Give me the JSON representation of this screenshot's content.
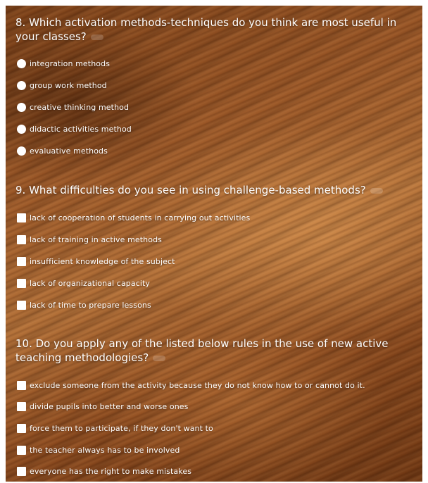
{
  "form": {
    "questions": [
      {
        "title": "8. Which activation methods-techniques do you think are most useful in your classes?",
        "input_type": "radio",
        "options": [
          "integration methods",
          "group work method",
          "creative thinking method",
          "didactic activities method",
          "evaluative methods"
        ]
      },
      {
        "title": "9. What difficulties do you see in using challenge-based methods?",
        "input_type": "checkbox",
        "options": [
          "lack of cooperation of students in carrying out activities",
          "lack of training in active methods",
          "insufficient knowledge of the subject",
          "lack of organizational capacity",
          "lack of time to prepare lessons"
        ]
      },
      {
        "title": "10. Do you apply any of the listed below rules in the use of new active teaching methodologies?",
        "input_type": "checkbox",
        "options": [
          "exclude someone from the activity because they do not know how to or cannot do it.",
          "divide pupils into better and worse ones",
          "force them to participate, if they don't want to",
          "the teacher always has to be involved",
          "everyone has the right to make mistakes"
        ]
      }
    ]
  },
  "colors": {
    "text": "#ffffff",
    "background_wood": "#9a5626"
  }
}
